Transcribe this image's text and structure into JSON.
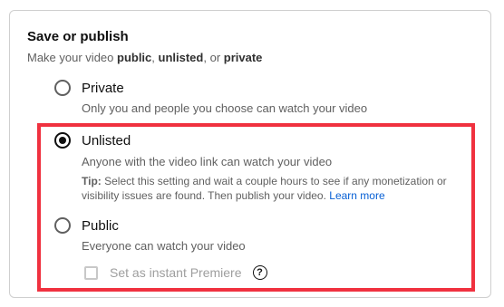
{
  "section": {
    "title": "Save or publish",
    "subtitle_prefix": "Make your video ",
    "subtitle_public": "public",
    "subtitle_sep1": ", ",
    "subtitle_unlisted": "unlisted",
    "subtitle_sep2": ", or ",
    "subtitle_private": "private"
  },
  "options": [
    {
      "label": "Private",
      "description": "Only you and people you choose can watch your video",
      "selected": false
    },
    {
      "label": "Unlisted",
      "description": "Anyone with the video link can watch your video",
      "selected": true
    },
    {
      "label": "Public",
      "description": "Everyone can watch your video",
      "selected": false
    }
  ],
  "tip": {
    "prefix": "Tip:",
    "text": " Select this setting and wait a couple hours to see if any monetization or visibility issues are found. Then publish your video. ",
    "link": "Learn more"
  },
  "premiere": {
    "label": "Set as instant Premiere",
    "checked": false,
    "help_icon": "question-circle-icon"
  },
  "colors": {
    "highlight": "#f0313f",
    "link": "#065fd4"
  }
}
